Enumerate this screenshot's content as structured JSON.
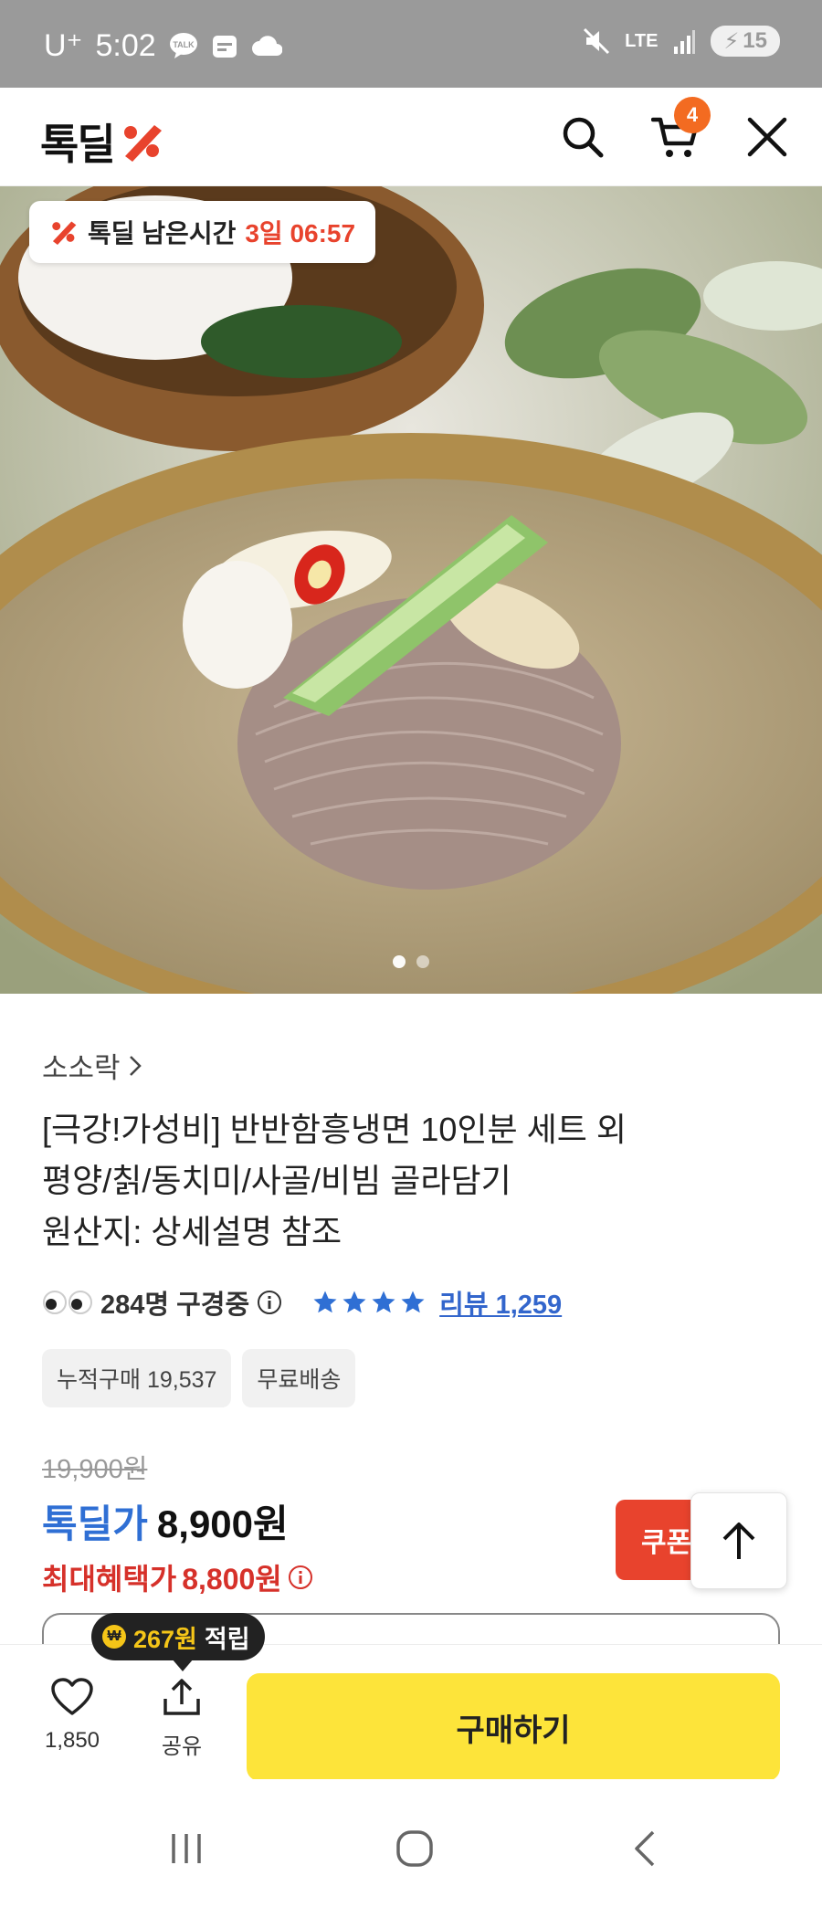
{
  "status_bar": {
    "carrier": "U⁺",
    "time": "5:02",
    "network": "LTE",
    "battery": "15"
  },
  "header": {
    "logo": "톡딜",
    "cart_count": "4",
    "icons": [
      "search-icon",
      "cart-icon",
      "close-icon"
    ]
  },
  "hero": {
    "timer_label": "톡딜 남은시간",
    "timer_value": "3일 06:57",
    "page_count": 2,
    "active_page": 1
  },
  "product": {
    "seller": "소소락",
    "title_lines": [
      "[극강!가성비] 반반함흥냉면 10인분 세트 외",
      "평양/칡/동치미/사골/비빔 골라담기",
      "원산지: 상세설명 참조"
    ],
    "viewers": "284명 구경중",
    "rating_stars": 4,
    "review_label": "리뷰 1,259",
    "tags": [
      "누적구매 19,537",
      "무료배송"
    ],
    "original_price": "19,900원",
    "deal_label": "톡딜가",
    "deal_price": "8,900원",
    "max_benefit_label": "최대혜택가",
    "max_benefit_price": "8,800원",
    "coupon_label": "쿠폰"
  },
  "action_bar": {
    "points_amount": "267원",
    "points_suffix": "적립",
    "like_count": "1,850",
    "share_label": "공유",
    "buy_label": "구매하기"
  },
  "colors": {
    "accent_red": "#e8432d",
    "deal_blue": "#2f6fd4",
    "buy_yellow": "#fde43a",
    "badge_orange": "#f36b21"
  }
}
